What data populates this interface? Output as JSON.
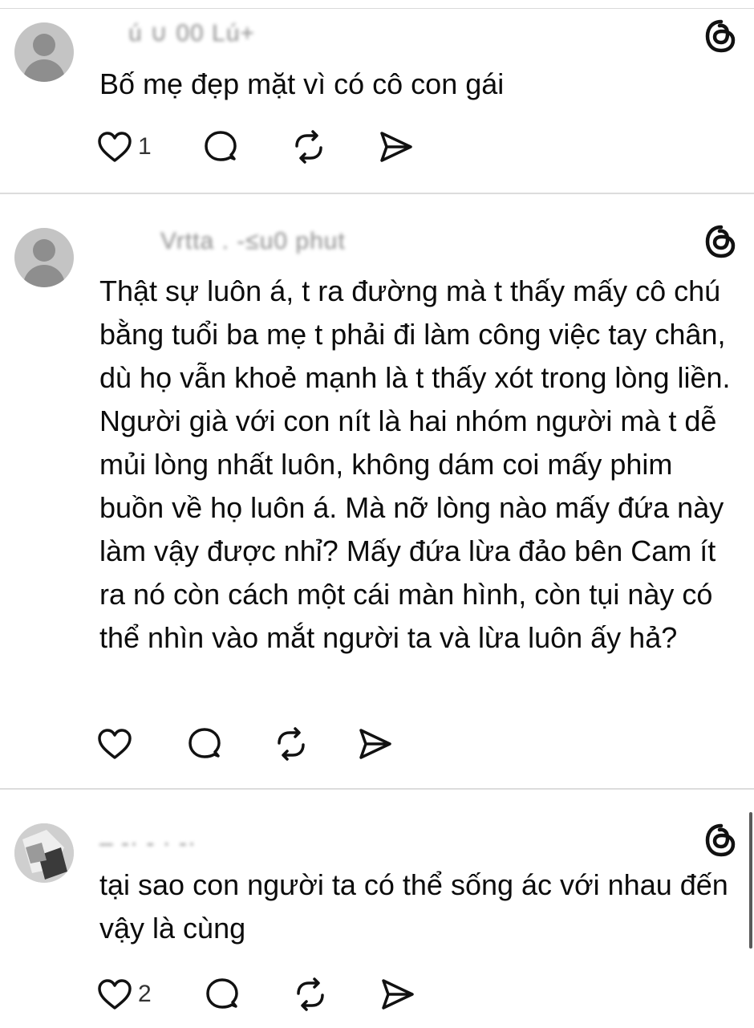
{
  "posts": [
    {
      "meta": "ú         ∪     00  Lú+",
      "text": "Bố mẹ đẹp mặt vì có cô con gái",
      "like_count": "1"
    },
    {
      "meta": "Vrtta .  -≤u0 phut",
      "text": "Thật sự luôn á, t ra đường mà t thấy mấy cô chú bằng tuổi ba mẹ t phải đi làm công việc tay chân, dù họ vẫn khoẻ mạnh là t thấy xót trong lòng liền. Người già với con nít là hai nhóm người mà t dễ mủi lòng nhất luôn, không dám coi mấy phim buồn về họ luôn á. Mà nỡ lòng nào mấy đứa này làm vậy được nhỉ? Mấy đứa lừa đảo bên Cam ít ra nó còn cách một cái màn hình, còn tụi này có thể nhìn vào mắt người ta và lừa luôn ấy hả?",
      "like_count": ""
    },
    {
      "meta": "–  -·     -  ·        -·",
      "text": "tại sao con người ta có thể sống ác với nhau đến vậy là cùng",
      "like_count": "2"
    }
  ],
  "icons": {
    "like": "heart-icon",
    "reply": "comment-bubble-icon",
    "repost": "repost-icon",
    "share": "send-icon",
    "brand": "threads-logo-icon"
  }
}
